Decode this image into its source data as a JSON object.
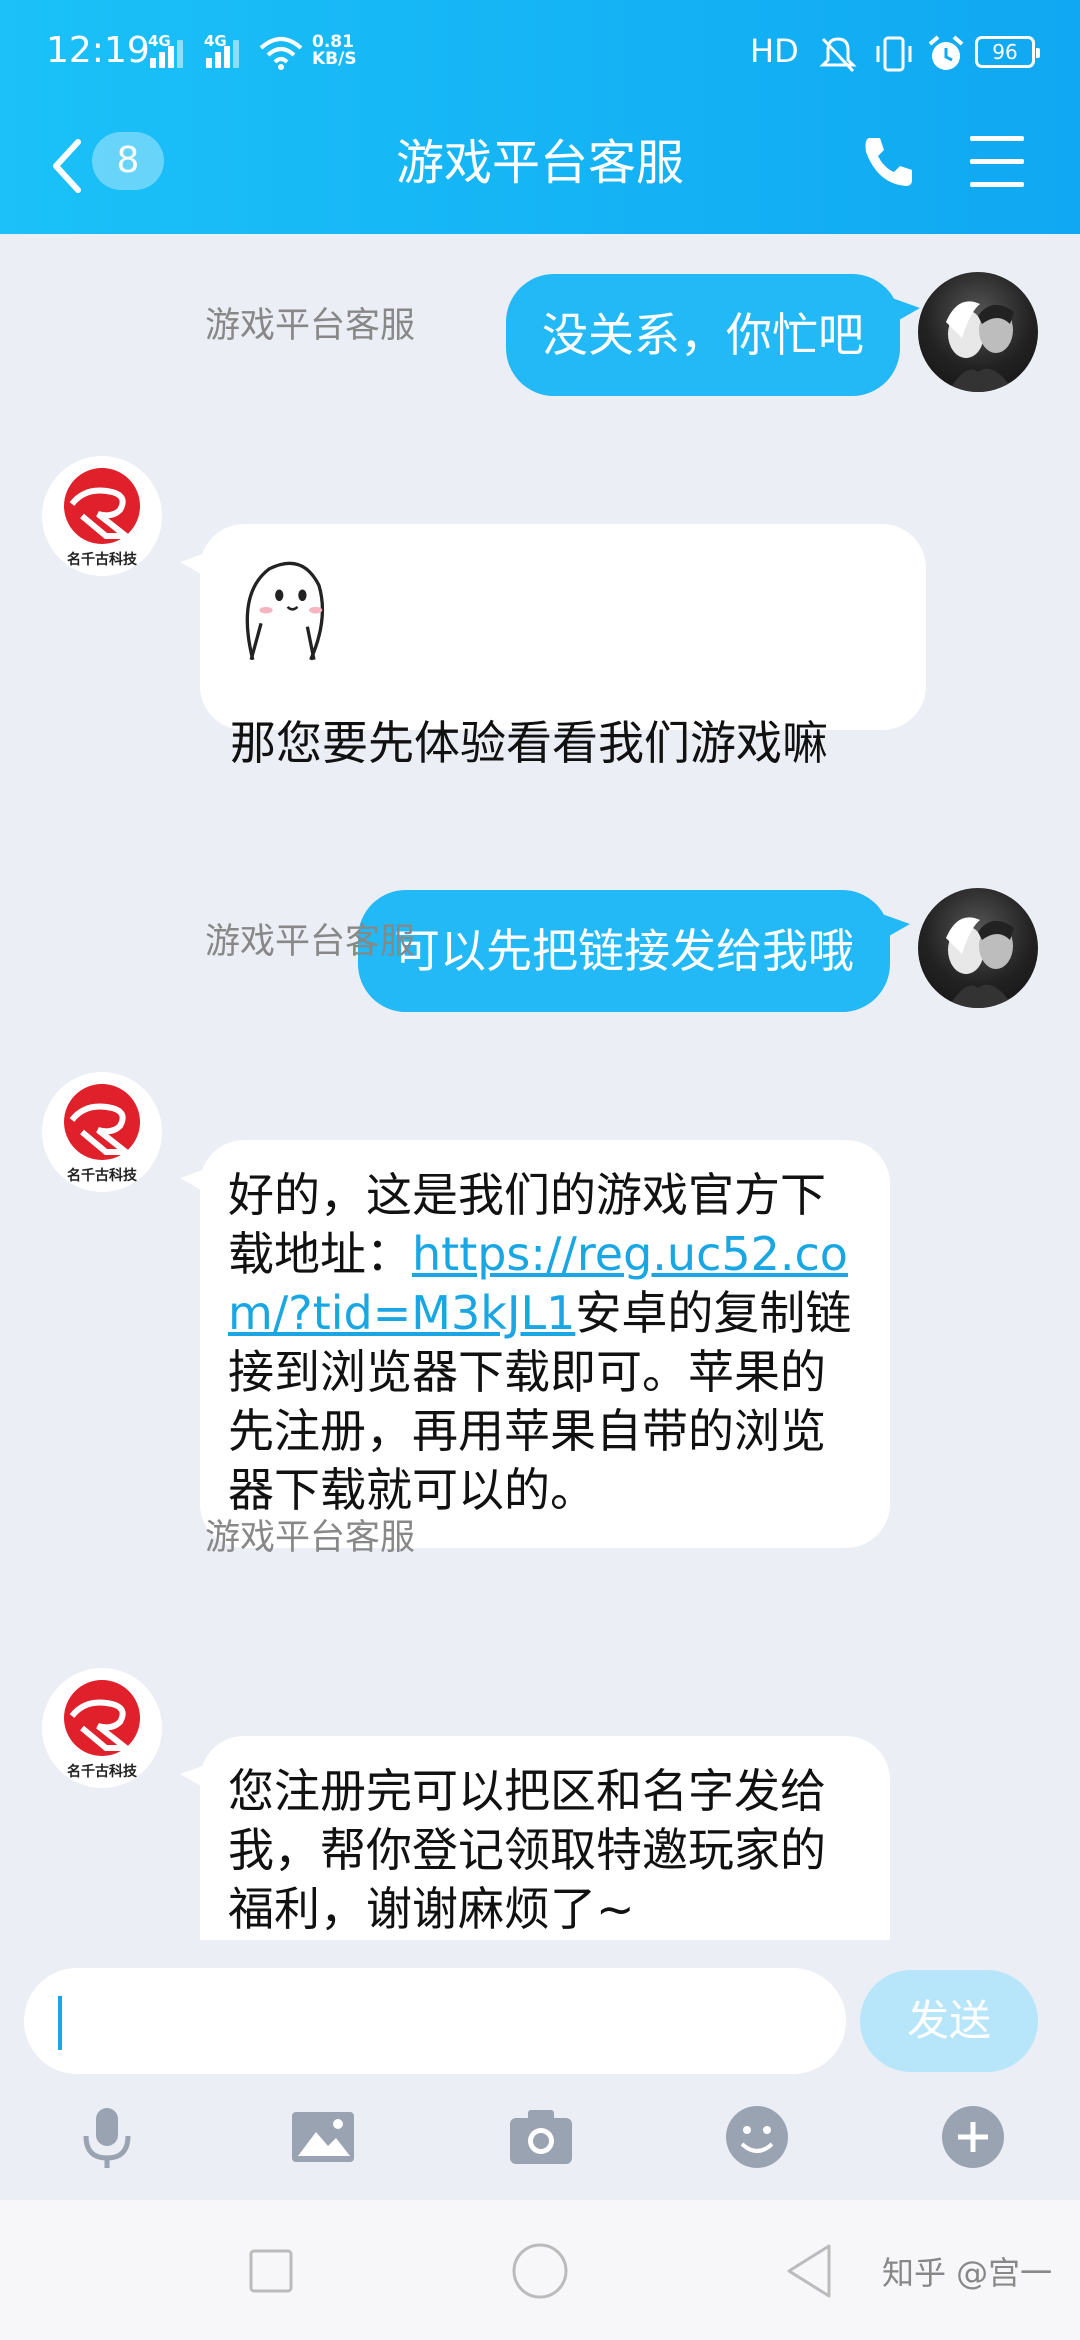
{
  "status_bar": {
    "time": "12:19",
    "net1": "4G",
    "net2": "4G",
    "speed_value": "0.81",
    "speed_unit": "KB/S",
    "hd": "HD",
    "battery": "96"
  },
  "header": {
    "unread_count": "8",
    "title": "游戏平台客服"
  },
  "messages": [
    {
      "from": "me",
      "text": "没关系，你忙吧"
    },
    {
      "from": "agent",
      "sender": "游戏平台客服",
      "text": "那您要先体验看看我们游戏嘛",
      "has_sticker": true
    },
    {
      "from": "me",
      "text": "可以先把链接发给我哦"
    },
    {
      "from": "agent",
      "sender": "游戏平台客服",
      "text_before": "好的，这是我们的游戏官方下载地址：",
      "link": "https://reg.uc52.com/?tid=M3kJL1",
      "text_after": "安卓的复制链接到浏览器下载即可。苹果的先注册，再用苹果自带的浏览器下载就可以的。"
    },
    {
      "from": "agent",
      "sender": "游戏平台客服",
      "text": "您注册完可以把区和名字发给我，帮你登记领取特邀玩家的福利，谢谢麻烦了~"
    }
  ],
  "agent_avatar_caption": "名千古科技",
  "input": {
    "value": "",
    "send_label": "发送"
  },
  "toolbar_icons": [
    "microphone-icon",
    "image-icon",
    "camera-icon",
    "emoji-icon",
    "plus-icon"
  ],
  "navbar_icons": [
    "recent-apps-icon",
    "home-icon",
    "back-icon"
  ],
  "watermark": "知乎 @宫一",
  "colors": {
    "header": "#10A8F2",
    "outgoing_bubble": "#23B8F6",
    "send_button": "#B7E6FA",
    "link": "#1AA6E2"
  }
}
